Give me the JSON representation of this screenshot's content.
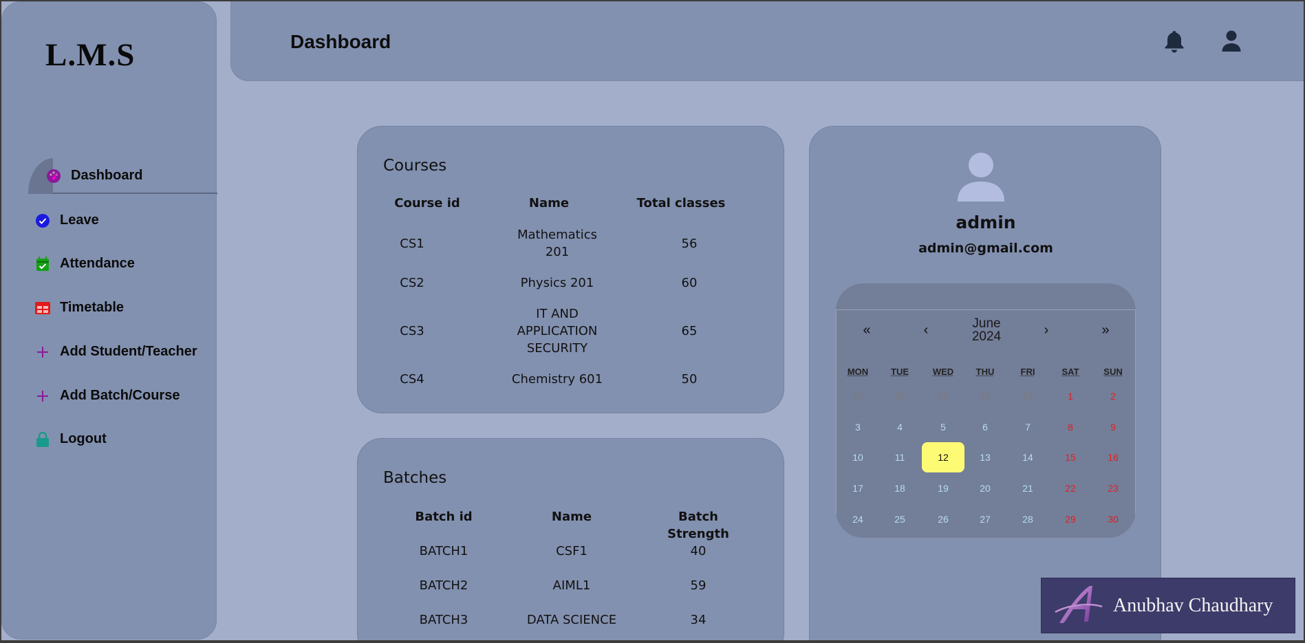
{
  "app": {
    "logo": "L.M.S"
  },
  "sidebar": {
    "items": [
      {
        "label": "Dashboard",
        "icon": "dashboard-gauge-icon",
        "color": "#8a1a9a",
        "active": true
      },
      {
        "label": "Leave",
        "icon": "check-circle-icon",
        "color": "#1a1ae0"
      },
      {
        "label": "Attendance",
        "icon": "calendar-check-icon",
        "color": "#15a015"
      },
      {
        "label": "Timetable",
        "icon": "table-icon",
        "color": "#e01a1a"
      },
      {
        "label": "Add Student/Teacher",
        "icon": "plus-icon",
        "color": "#8a1a9a"
      },
      {
        "label": "Add Batch/Course",
        "icon": "plus-icon",
        "color": "#8a1a9a"
      },
      {
        "label": "Logout",
        "icon": "lock-icon",
        "color": "#1a9a8a"
      }
    ]
  },
  "header": {
    "title": "Dashboard",
    "icons": [
      "bell-icon",
      "user-icon"
    ]
  },
  "courses": {
    "title": "Courses",
    "columns": [
      "Course id",
      "Name",
      "Total classes"
    ],
    "rows": [
      {
        "id": "CS1",
        "name": "Mathematics 201",
        "total": "56"
      },
      {
        "id": "CS2",
        "name": "Physics 201",
        "total": "60"
      },
      {
        "id": "CS3",
        "name": "IT AND APPLICATION SECURITY",
        "total": "65"
      },
      {
        "id": "CS4",
        "name": "Chemistry 601",
        "total": "50"
      }
    ]
  },
  "batches": {
    "title": "Batches",
    "columns": [
      "Batch id",
      "Name",
      "Batch Strength"
    ],
    "rows": [
      {
        "id": "BATCH1",
        "name": "CSF1",
        "strength": "40"
      },
      {
        "id": "BATCH2",
        "name": "AIML1",
        "strength": "59"
      },
      {
        "id": "BATCH3",
        "name": "DATA SCIENCE",
        "strength": "34"
      }
    ]
  },
  "profile": {
    "name": "admin",
    "email": "admin@gmail.com"
  },
  "calendar": {
    "nav": {
      "prev_year": "«",
      "prev_month": "‹",
      "next_month": "›",
      "next_year": "»"
    },
    "month": "June",
    "year": "2024",
    "weekdays": [
      "MON",
      "TUE",
      "WED",
      "THU",
      "FRI",
      "SAT",
      "SUN"
    ],
    "weeks": [
      [
        "27",
        "28",
        "29",
        "30",
        "31",
        "1",
        "2"
      ],
      [
        "3",
        "4",
        "5",
        "6",
        "7",
        "8",
        "9"
      ],
      [
        "10",
        "11",
        "12",
        "13",
        "14",
        "15",
        "16"
      ],
      [
        "17",
        "18",
        "19",
        "20",
        "21",
        "22",
        "23"
      ],
      [
        "24",
        "25",
        "26",
        "27",
        "28",
        "29",
        "30"
      ]
    ],
    "selected_day": "12",
    "colors": {
      "weekday": "#b8dcf0",
      "weekend": "#e02020",
      "other_month": "#7a7a7a",
      "selected_bg": "#fdfb74"
    }
  },
  "watermark": {
    "name": "Anubhav Chaudhary",
    "logo_letter": "A"
  }
}
